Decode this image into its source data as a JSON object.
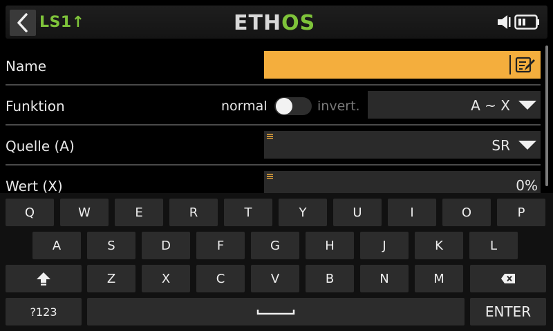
{
  "header": {
    "title": "LS1",
    "title_arrow": "↑",
    "brand_white": "ETH",
    "brand_green": "OS"
  },
  "form": {
    "name": {
      "label": "Name",
      "value": ""
    },
    "function": {
      "label": "Funktion",
      "toggle_off_label": "normal",
      "toggle_on_label": "invert.",
      "toggle_on": false,
      "value": "A ~ X"
    },
    "source": {
      "label": "Quelle (A)",
      "value": "SR"
    },
    "value": {
      "label": "Wert (X)",
      "value": "0%"
    }
  },
  "keyboard": {
    "row1": [
      "Q",
      "W",
      "E",
      "R",
      "T",
      "Y",
      "U",
      "I",
      "O",
      "P"
    ],
    "row2": [
      "A",
      "S",
      "D",
      "F",
      "G",
      "H",
      "J",
      "K",
      "L"
    ],
    "row3": [
      "Z",
      "X",
      "C",
      "V",
      "B",
      "N",
      "M"
    ],
    "symbols_label": "?123",
    "enter_label": "ENTER"
  },
  "colors": {
    "accent_green": "#7ec33a",
    "field_orange": "#f4ae3d"
  },
  "icons": [
    "back-arrow-icon",
    "speaker-icon",
    "battery-icon",
    "edit-icon",
    "shift-icon",
    "backspace-icon",
    "space-icon",
    "dropdown-caret-icon",
    "drag-handle-icon"
  ]
}
